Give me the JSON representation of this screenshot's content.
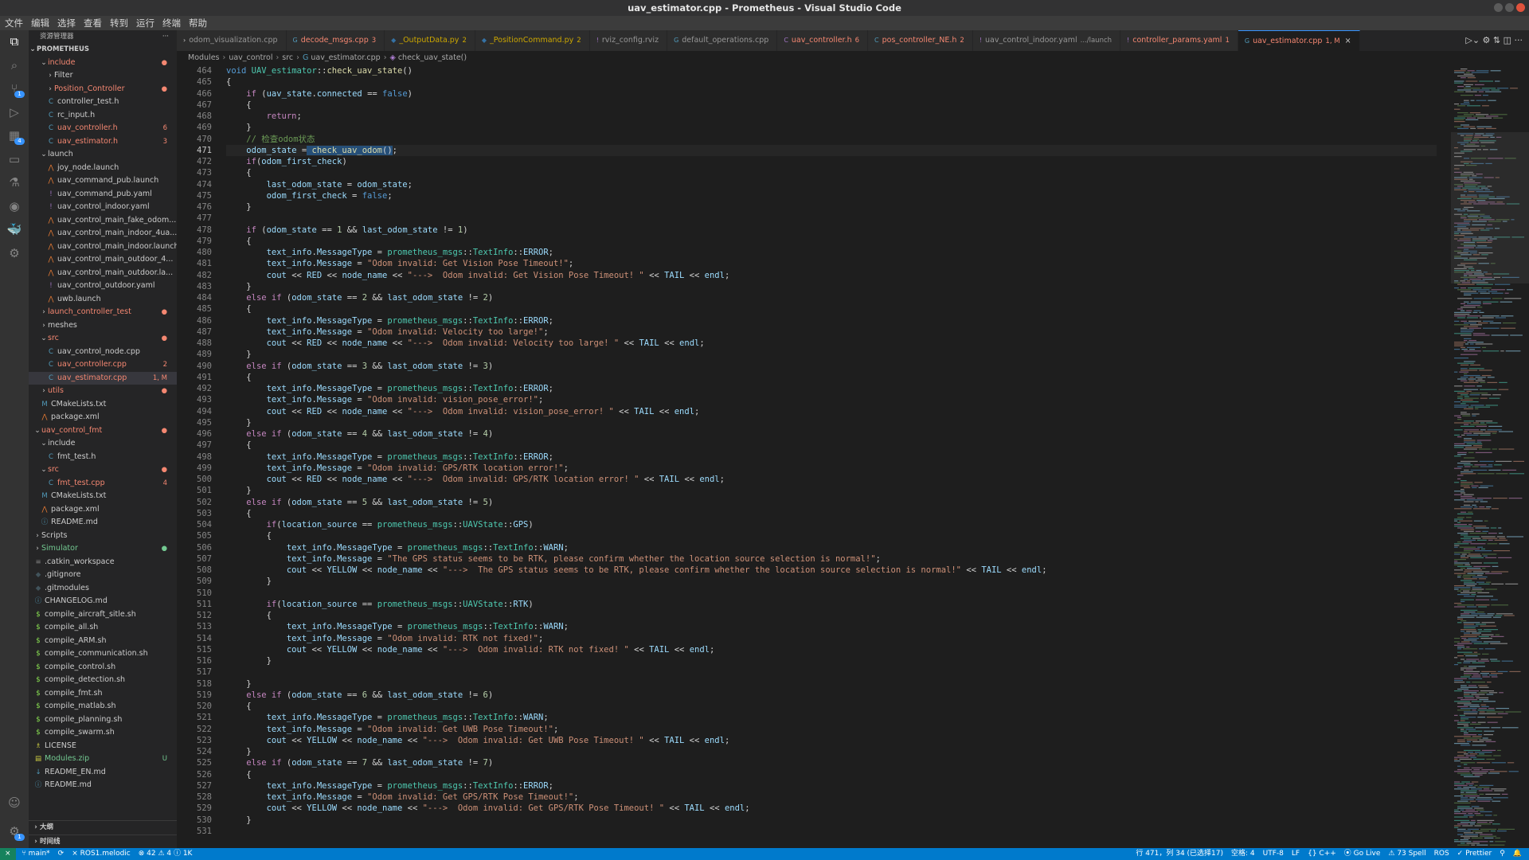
{
  "window": {
    "title": "uav_estimator.cpp - Prometheus - Visual Studio Code"
  },
  "menu": [
    "文件",
    "编辑",
    "选择",
    "查看",
    "转到",
    "运行",
    "终端",
    "帮助"
  ],
  "activity_bar": [
    {
      "name": "explorer-icon",
      "glyph": "⧉",
      "active": true
    },
    {
      "name": "search-icon",
      "glyph": "⌕"
    },
    {
      "name": "source-control-icon",
      "glyph": "⑂",
      "badge": "1"
    },
    {
      "name": "run-debug-icon",
      "glyph": "▷"
    },
    {
      "name": "extensions-icon",
      "glyph": "▦",
      "badge": "4"
    },
    {
      "name": "remote-explorer-icon",
      "glyph": "▭"
    },
    {
      "name": "testing-icon",
      "glyph": "⚗"
    },
    {
      "name": "github-icon",
      "glyph": "◉"
    },
    {
      "name": "docker-icon",
      "glyph": "🐳"
    },
    {
      "name": "ros-icon",
      "glyph": "⚙"
    }
  ],
  "activity_bottom": [
    {
      "name": "accounts-icon",
      "glyph": "☺"
    },
    {
      "name": "manage-gear-icon",
      "glyph": "⚙",
      "badge": "1"
    }
  ],
  "sidebar": {
    "header": "资源管理器",
    "more": "···",
    "root": "PROMETHEUS",
    "tree": [
      {
        "indent": 2,
        "chev": "⌄",
        "label": "include",
        "git": "e",
        "deco": "●"
      },
      {
        "indent": 3,
        "chev": "›",
        "label": "Filter"
      },
      {
        "indent": 3,
        "chev": "›",
        "label": "Position_Controller",
        "git": "e",
        "deco": "●"
      },
      {
        "indent": 3,
        "icon": "C",
        "icolor": "#519aba",
        "label": "controller_test.h"
      },
      {
        "indent": 3,
        "icon": "C",
        "icolor": "#519aba",
        "label": "rc_input.h"
      },
      {
        "indent": 3,
        "icon": "C",
        "icolor": "#519aba",
        "label": "uav_controller.h",
        "git": "e",
        "deco": "6"
      },
      {
        "indent": 3,
        "icon": "C",
        "icolor": "#519aba",
        "label": "uav_estimator.h",
        "git": "e",
        "deco": "3"
      },
      {
        "indent": 2,
        "chev": "⌄",
        "label": "launch"
      },
      {
        "indent": 3,
        "icon": "⋀",
        "icolor": "#e37933",
        "label": "joy_node.launch"
      },
      {
        "indent": 3,
        "icon": "⋀",
        "icolor": "#e37933",
        "label": "uav_command_pub.launch"
      },
      {
        "indent": 3,
        "icon": "!",
        "icolor": "#a074c4",
        "label": "uav_command_pub.yaml"
      },
      {
        "indent": 3,
        "icon": "!",
        "icolor": "#a074c4",
        "label": "uav_control_indoor.yaml"
      },
      {
        "indent": 3,
        "icon": "⋀",
        "icolor": "#e37933",
        "label": "uav_control_main_fake_odom..."
      },
      {
        "indent": 3,
        "icon": "⋀",
        "icolor": "#e37933",
        "label": "uav_control_main_indoor_4ua..."
      },
      {
        "indent": 3,
        "icon": "⋀",
        "icolor": "#e37933",
        "label": "uav_control_main_indoor.launch"
      },
      {
        "indent": 3,
        "icon": "⋀",
        "icolor": "#e37933",
        "label": "uav_control_main_outdoor_4..."
      },
      {
        "indent": 3,
        "icon": "⋀",
        "icolor": "#e37933",
        "label": "uav_control_main_outdoor.la..."
      },
      {
        "indent": 3,
        "icon": "!",
        "icolor": "#a074c4",
        "label": "uav_control_outdoor.yaml"
      },
      {
        "indent": 3,
        "icon": "⋀",
        "icolor": "#e37933",
        "label": "uwb.launch"
      },
      {
        "indent": 2,
        "chev": "›",
        "label": "launch_controller_test",
        "git": "e",
        "deco": "●"
      },
      {
        "indent": 2,
        "chev": "›",
        "label": "meshes"
      },
      {
        "indent": 2,
        "chev": "⌄",
        "label": "src",
        "git": "e",
        "deco": "●"
      },
      {
        "indent": 3,
        "icon": "C",
        "icolor": "#519aba",
        "label": "uav_control_node.cpp"
      },
      {
        "indent": 3,
        "icon": "C",
        "icolor": "#519aba",
        "label": "uav_controller.cpp",
        "git": "e",
        "deco": "2"
      },
      {
        "indent": 3,
        "icon": "C",
        "icolor": "#519aba",
        "label": "uav_estimator.cpp",
        "git": "e",
        "deco": "1, M",
        "selected": true
      },
      {
        "indent": 2,
        "chev": "›",
        "label": "utils",
        "git": "e",
        "deco": "●"
      },
      {
        "indent": 2,
        "icon": "M",
        "icolor": "#519aba",
        "label": "CMakeLists.txt"
      },
      {
        "indent": 2,
        "icon": "⋀",
        "icolor": "#e37933",
        "label": "package.xml"
      },
      {
        "indent": 1,
        "chev": "⌄",
        "label": "uav_control_fmt",
        "git": "e",
        "deco": "●"
      },
      {
        "indent": 2,
        "chev": "⌄",
        "label": "include"
      },
      {
        "indent": 3,
        "icon": "C",
        "icolor": "#519aba",
        "label": "fmt_test.h"
      },
      {
        "indent": 2,
        "chev": "⌄",
        "label": "src",
        "git": "e",
        "deco": "●"
      },
      {
        "indent": 3,
        "icon": "C",
        "icolor": "#519aba",
        "label": "fmt_test.cpp",
        "git": "e",
        "deco": "4"
      },
      {
        "indent": 2,
        "icon": "M",
        "icolor": "#519aba",
        "label": "CMakeLists.txt"
      },
      {
        "indent": 2,
        "icon": "⋀",
        "icolor": "#e37933",
        "label": "package.xml"
      },
      {
        "indent": 2,
        "icon": "ⓘ",
        "icolor": "#519aba",
        "label": "README.md"
      },
      {
        "indent": 1,
        "chev": "›",
        "label": "Scripts"
      },
      {
        "indent": 1,
        "chev": "›",
        "label": "Simulator",
        "git": "u",
        "deco": "●"
      },
      {
        "indent": 1,
        "icon": "≡",
        "icolor": "#858585",
        "label": ".catkin_workspace"
      },
      {
        "indent": 1,
        "icon": "◆",
        "icolor": "#41535b",
        "label": ".gitignore"
      },
      {
        "indent": 1,
        "icon": "◆",
        "icolor": "#41535b",
        "label": ".gitmodules"
      },
      {
        "indent": 1,
        "icon": "ⓘ",
        "icolor": "#519aba",
        "label": "CHANGELOG.md"
      },
      {
        "indent": 1,
        "icon": "$",
        "icolor": "#89e051",
        "label": "compile_aircraft_sitle.sh"
      },
      {
        "indent": 1,
        "icon": "$",
        "icolor": "#89e051",
        "label": "compile_all.sh"
      },
      {
        "indent": 1,
        "icon": "$",
        "icolor": "#89e051",
        "label": "compile_ARM.sh"
      },
      {
        "indent": 1,
        "icon": "$",
        "icolor": "#89e051",
        "label": "compile_communication.sh"
      },
      {
        "indent": 1,
        "icon": "$",
        "icolor": "#89e051",
        "label": "compile_control.sh"
      },
      {
        "indent": 1,
        "icon": "$",
        "icolor": "#89e051",
        "label": "compile_detection.sh"
      },
      {
        "indent": 1,
        "icon": "$",
        "icolor": "#89e051",
        "label": "compile_fmt.sh"
      },
      {
        "indent": 1,
        "icon": "$",
        "icolor": "#89e051",
        "label": "compile_matlab.sh"
      },
      {
        "indent": 1,
        "icon": "$",
        "icolor": "#89e051",
        "label": "compile_planning.sh"
      },
      {
        "indent": 1,
        "icon": "$",
        "icolor": "#89e051",
        "label": "compile_swarm.sh"
      },
      {
        "indent": 1,
        "icon": "♗",
        "icolor": "#cbcb41",
        "label": "LICENSE"
      },
      {
        "indent": 1,
        "icon": "▤",
        "icolor": "#cbcb41",
        "label": "Modules.zip",
        "git": "u",
        "deco": "U"
      },
      {
        "indent": 1,
        "icon": "↓",
        "icolor": "#519aba",
        "label": "README_EN.md"
      },
      {
        "indent": 1,
        "icon": "ⓘ",
        "icolor": "#519aba",
        "label": "README.md"
      }
    ],
    "bottom_sections": [
      "大纲",
      "时间线"
    ]
  },
  "tabs": [
    {
      "icon": "›",
      "icolor": "#cccccc",
      "label": "odom_visualization.cpp"
    },
    {
      "icon": "G",
      "icolor": "#519aba",
      "label": "decode_msgs.cpp",
      "deco": "3",
      "state": "err"
    },
    {
      "icon": "◆",
      "icolor": "#3572a5",
      "label": "_OutputData.py",
      "deco": "2",
      "state": "warn"
    },
    {
      "icon": "◆",
      "icolor": "#3572a5",
      "label": "_PositionCommand.py",
      "deco": "2",
      "state": "warn"
    },
    {
      "icon": "!",
      "icolor": "#a074c4",
      "label": "rviz_config.rviz"
    },
    {
      "icon": "G",
      "icolor": "#519aba",
      "label": "default_operations.cpp"
    },
    {
      "icon": "C",
      "icolor": "#a074c4",
      "label": "uav_controller.h",
      "deco": "6",
      "state": "err"
    },
    {
      "icon": "C",
      "icolor": "#519aba",
      "label": "pos_controller_NE.h",
      "deco": "2",
      "state": "err"
    },
    {
      "icon": "!",
      "icolor": "#a074c4",
      "label": "uav_control_indoor.yaml",
      "deco": ".../launch"
    },
    {
      "icon": "!",
      "icolor": "#a074c4",
      "label": "controller_params.yaml",
      "deco": "1",
      "state": "err"
    },
    {
      "icon": "G",
      "icolor": "#519aba",
      "label": "uav_estimator.cpp",
      "deco": "1, M",
      "active": true,
      "state": "err"
    }
  ],
  "tab_actions": "▷⌄  ⚙  ⇅  ◫  ···",
  "breadcrumb": [
    "Modules",
    "uav_control",
    "src",
    "uav_estimator.cpp",
    "check_uav_state()"
  ],
  "editor": {
    "first_line": 464,
    "current_line": 471,
    "lines": [
      "<span class=\"k\">void</span> <span class=\"t\">UAV_estimator</span>::<span class=\"f\">check_uav_state</span>()",
      "{",
      "    <span class=\"c\">if</span> (<span class=\"v\">uav_state</span>.<span class=\"v\">connected</span> == <span class=\"k\">false</span>)",
      "    {",
      "        <span class=\"c\">return</span>;",
      "    }",
      "    <span class=\"m\">// 检查odom状态</span>",
      "    <span class=\"v\">odom_state</span> =<span class=\"hl\"> <span class=\"f\">check_uav_odom</span>()</span>;",
      "    <span class=\"c\">if</span>(<span class=\"v\">odom_first_check</span>)",
      "    {",
      "        <span class=\"v\">last_odom_state</span> = <span class=\"v\">odom_state</span>;",
      "        <span class=\"v\">odom_first_check</span> = <span class=\"k\">false</span>;",
      "    }",
      "",
      "    <span class=\"c\">if</span> (<span class=\"v\">odom_state</span> == <span class=\"n\">1</span> &amp;&amp; <span class=\"v\">last_odom_state</span> != <span class=\"n\">1</span>)",
      "    {",
      "        <span class=\"v\">text_info</span>.<span class=\"v\">MessageType</span> = <span class=\"t\">prometheus_msgs</span>::<span class=\"t\">TextInfo</span>::<span class=\"v\">ERROR</span>;",
      "        <span class=\"v\">text_info</span>.<span class=\"v\">Message</span> = <span class=\"s\">\"Odom invalid: Get Vision Pose Timeout!\"</span>;",
      "        <span class=\"v\">cout</span> &lt;&lt; <span class=\"v\">RED</span> &lt;&lt; <span class=\"v\">node_name</span> &lt;&lt; <span class=\"s\">\"---&gt;  Odom invalid: Get Vision Pose Timeout! \"</span> &lt;&lt; <span class=\"v\">TAIL</span> &lt;&lt; <span class=\"v\">endl</span>;",
      "    }",
      "    <span class=\"c\">else</span> <span class=\"c\">if</span> (<span class=\"v\">odom_state</span> == <span class=\"n\">2</span> &amp;&amp; <span class=\"v\">last_odom_state</span> != <span class=\"n\">2</span>)",
      "    {",
      "        <span class=\"v\">text_info</span>.<span class=\"v\">MessageType</span> = <span class=\"t\">prometheus_msgs</span>::<span class=\"t\">TextInfo</span>::<span class=\"v\">ERROR</span>;",
      "        <span class=\"v\">text_info</span>.<span class=\"v\">Message</span> = <span class=\"s\">\"Odom invalid: Velocity too large!\"</span>;",
      "        <span class=\"v\">cout</span> &lt;&lt; <span class=\"v\">RED</span> &lt;&lt; <span class=\"v\">node_name</span> &lt;&lt; <span class=\"s\">\"---&gt;  Odom invalid: Velocity too large! \"</span> &lt;&lt; <span class=\"v\">TAIL</span> &lt;&lt; <span class=\"v\">endl</span>;",
      "    }",
      "    <span class=\"c\">else</span> <span class=\"c\">if</span> (<span class=\"v\">odom_state</span> == <span class=\"n\">3</span> &amp;&amp; <span class=\"v\">last_odom_state</span> != <span class=\"n\">3</span>)",
      "    {",
      "        <span class=\"v\">text_info</span>.<span class=\"v\">MessageType</span> = <span class=\"t\">prometheus_msgs</span>::<span class=\"t\">TextInfo</span>::<span class=\"v\">ERROR</span>;",
      "        <span class=\"v\">text_info</span>.<span class=\"v\">Message</span> = <span class=\"s\">\"Odom invalid: vision_pose_error!\"</span>;",
      "        <span class=\"v\">cout</span> &lt;&lt; <span class=\"v\">RED</span> &lt;&lt; <span class=\"v\">node_name</span> &lt;&lt; <span class=\"s\">\"---&gt;  Odom invalid: vision_pose_error! \"</span> &lt;&lt; <span class=\"v\">TAIL</span> &lt;&lt; <span class=\"v\">endl</span>;",
      "    }",
      "    <span class=\"c\">else</span> <span class=\"c\">if</span> (<span class=\"v\">odom_state</span> == <span class=\"n\">4</span> &amp;&amp; <span class=\"v\">last_odom_state</span> != <span class=\"n\">4</span>)",
      "    {",
      "        <span class=\"v\">text_info</span>.<span class=\"v\">MessageType</span> = <span class=\"t\">prometheus_msgs</span>::<span class=\"t\">TextInfo</span>::<span class=\"v\">ERROR</span>;",
      "        <span class=\"v\">text_info</span>.<span class=\"v\">Message</span> = <span class=\"s\">\"Odom invalid: GPS/RTK location error!\"</span>;",
      "        <span class=\"v\">cout</span> &lt;&lt; <span class=\"v\">RED</span> &lt;&lt; <span class=\"v\">node_name</span> &lt;&lt; <span class=\"s\">\"---&gt;  Odom invalid: GPS/RTK location error! \"</span> &lt;&lt; <span class=\"v\">TAIL</span> &lt;&lt; <span class=\"v\">endl</span>;",
      "    }",
      "    <span class=\"c\">else</span> <span class=\"c\">if</span> (<span class=\"v\">odom_state</span> == <span class=\"n\">5</span> &amp;&amp; <span class=\"v\">last_odom_state</span> != <span class=\"n\">5</span>)",
      "    {",
      "        <span class=\"c\">if</span>(<span class=\"v\">location_source</span> == <span class=\"t\">prometheus_msgs</span>::<span class=\"t\">UAVState</span>::<span class=\"v\">GPS</span>)",
      "        {",
      "            <span class=\"v\">text_info</span>.<span class=\"v\">MessageType</span> = <span class=\"t\">prometheus_msgs</span>::<span class=\"t\">TextInfo</span>::<span class=\"v\">WARN</span>;",
      "            <span class=\"v\">text_info</span>.<span class=\"v\">Message</span> = <span class=\"s\">\"The GPS status seems to be RTK, please confirm whether the location source selection is normal!\"</span>;",
      "            <span class=\"v\">cout</span> &lt;&lt; <span class=\"v\">YELLOW</span> &lt;&lt; <span class=\"v\">node_name</span> &lt;&lt; <span class=\"s\">\"---&gt;  The GPS status seems to be RTK, please confirm whether the location source selection is normal!\"</span> &lt;&lt; <span class=\"v\">TAIL</span> &lt;&lt; <span class=\"v\">endl</span>;",
      "        }",
      "",
      "        <span class=\"c\">if</span>(<span class=\"v\">location_source</span> == <span class=\"t\">prometheus_msgs</span>::<span class=\"t\">UAVState</span>::<span class=\"v\">RTK</span>)",
      "        {",
      "            <span class=\"v\">text_info</span>.<span class=\"v\">MessageType</span> = <span class=\"t\">prometheus_msgs</span>::<span class=\"t\">TextInfo</span>::<span class=\"v\">WARN</span>;",
      "            <span class=\"v\">text_info</span>.<span class=\"v\">Message</span> = <span class=\"s\">\"Odom invalid: RTK not fixed!\"</span>;",
      "            <span class=\"v\">cout</span> &lt;&lt; <span class=\"v\">YELLOW</span> &lt;&lt; <span class=\"v\">node_name</span> &lt;&lt; <span class=\"s\">\"---&gt;  Odom invalid: RTK not fixed! \"</span> &lt;&lt; <span class=\"v\">TAIL</span> &lt;&lt; <span class=\"v\">endl</span>;",
      "        }",
      "",
      "    }",
      "    <span class=\"c\">else</span> <span class=\"c\">if</span> (<span class=\"v\">odom_state</span> == <span class=\"n\">6</span> &amp;&amp; <span class=\"v\">last_odom_state</span> != <span class=\"n\">6</span>)",
      "    {",
      "        <span class=\"v\">text_info</span>.<span class=\"v\">MessageType</span> = <span class=\"t\">prometheus_msgs</span>::<span class=\"t\">TextInfo</span>::<span class=\"v\">WARN</span>;",
      "        <span class=\"v\">text_info</span>.<span class=\"v\">Message</span> = <span class=\"s\">\"Odom invalid: Get UWB Pose Timeout!\"</span>;",
      "        <span class=\"v\">cout</span> &lt;&lt; <span class=\"v\">YELLOW</span> &lt;&lt; <span class=\"v\">node_name</span> &lt;&lt; <span class=\"s\">\"---&gt;  Odom invalid: Get UWB Pose Timeout! \"</span> &lt;&lt; <span class=\"v\">TAIL</span> &lt;&lt; <span class=\"v\">endl</span>;",
      "    }",
      "    <span class=\"c\">else</span> <span class=\"c\">if</span> (<span class=\"v\">odom_state</span> == <span class=\"n\">7</span> &amp;&amp; <span class=\"v\">last_odom_state</span> != <span class=\"n\">7</span>)",
      "    {",
      "        <span class=\"v\">text_info</span>.<span class=\"v\">MessageType</span> = <span class=\"t\">prometheus_msgs</span>::<span class=\"t\">TextInfo</span>::<span class=\"v\">ERROR</span>;",
      "        <span class=\"v\">text_info</span>.<span class=\"v\">Message</span> = <span class=\"s\">\"Odom invalid: Get GPS/RTK Pose Timeout!\"</span>;",
      "        <span class=\"v\">cout</span> &lt;&lt; <span class=\"v\">YELLOW</span> &lt;&lt; <span class=\"v\">node_name</span> &lt;&lt; <span class=\"s\">\"---&gt;  Odom invalid: Get GPS/RTK Pose Timeout! \"</span> &lt;&lt; <span class=\"v\">TAIL</span> &lt;&lt; <span class=\"v\">endl</span>;",
      "    }",
      ""
    ]
  },
  "statusbar": {
    "remote": "⨯",
    "left": [
      "⑂ main*",
      "⟳",
      "⨯ ROS1.melodic",
      "⊗ 42 ⚠ 4 ⓘ 1K"
    ],
    "right": [
      "行 471，列 34 (已选择17)",
      "空格: 4",
      "UTF-8",
      "LF",
      "{} C++",
      "⦿ Go Live",
      "⚠ 73 Spell",
      "ROS",
      "✓ Prettier",
      "⚲",
      "🔔"
    ]
  }
}
